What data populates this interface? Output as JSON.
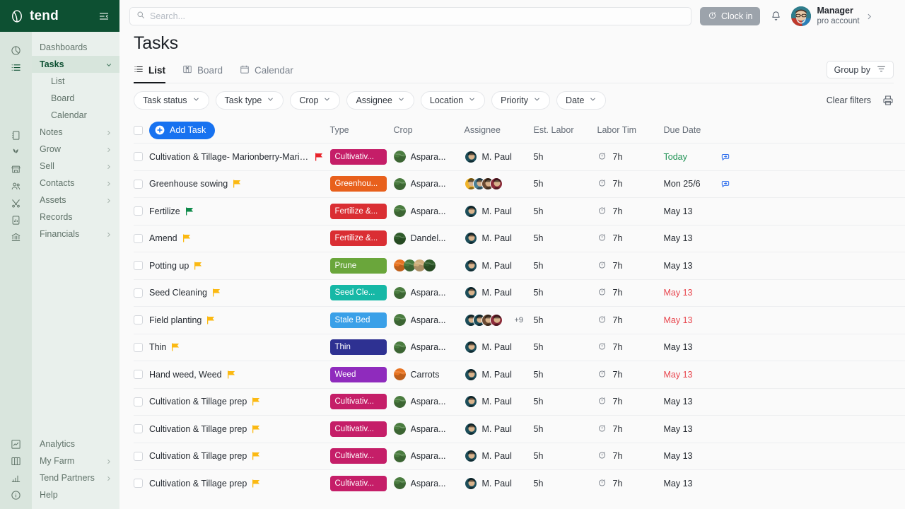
{
  "brand": {
    "name": "tend",
    "logo_icon": "tend-logo-icon",
    "collapse_icon": "collapse-sidebar-icon"
  },
  "sidebar": {
    "items": [
      {
        "label": "Dashboards",
        "icon": "pie-chart-icon",
        "active": false,
        "expandable": false
      },
      {
        "label": "Tasks",
        "icon": "list-icon",
        "active": true,
        "expandable": true
      },
      {
        "label": "Notes",
        "icon": "notebook-icon",
        "active": false,
        "expandable": true
      },
      {
        "label": "Grow",
        "icon": "sprout-icon",
        "active": false,
        "expandable": true
      },
      {
        "label": "Sell",
        "icon": "store-icon",
        "active": false,
        "expandable": true
      },
      {
        "label": "Contacts",
        "icon": "people-icon",
        "active": false,
        "expandable": true
      },
      {
        "label": "Assets",
        "icon": "tools-icon",
        "active": false,
        "expandable": true
      },
      {
        "label": "Records",
        "icon": "clipboard-chart-icon",
        "active": false,
        "expandable": false
      },
      {
        "label": "Financials",
        "icon": "bank-icon",
        "active": false,
        "expandable": true
      }
    ],
    "sub_items": [
      {
        "label": "List"
      },
      {
        "label": "Board"
      },
      {
        "label": "Calendar"
      }
    ],
    "bottom_items": [
      {
        "label": "Analytics",
        "icon": "line-chart-icon",
        "expandable": false
      },
      {
        "label": "My Farm",
        "icon": "columns-icon",
        "expandable": true
      },
      {
        "label": "Tend Partners",
        "icon": "bar-chart-icon",
        "expandable": true
      },
      {
        "label": "Help",
        "icon": "info-icon",
        "expandable": false
      }
    ]
  },
  "topbar": {
    "search_placeholder": "Search...",
    "search_value": "",
    "clock_in_label": "Clock in",
    "user_name": "Manager",
    "user_subtitle": "pro account"
  },
  "page": {
    "title": "Tasks",
    "tabs": [
      {
        "label": "List",
        "icon": "list-view-icon",
        "active": true
      },
      {
        "label": "Board",
        "icon": "board-view-icon",
        "active": false
      },
      {
        "label": "Calendar",
        "icon": "calendar-view-icon",
        "active": false
      }
    ],
    "group_by_label": "Group by",
    "clear_filters_label": "Clear filters",
    "filters": [
      {
        "label": "Task status"
      },
      {
        "label": "Task type"
      },
      {
        "label": "Crop"
      },
      {
        "label": "Assignee"
      },
      {
        "label": "Location"
      },
      {
        "label": "Priority"
      },
      {
        "label": "Date"
      }
    ]
  },
  "table": {
    "add_task_label": "Add Task",
    "columns": [
      "Type",
      "Crop",
      "Assignee",
      "Est. Labor",
      "Labor Tim",
      "Due Date"
    ],
    "rows": [
      {
        "name": "Cultivation & Tillage- Marionberry-Marionberry Generic - Ngu...",
        "flag": "#e8232a",
        "type": "Cultivativ...",
        "type_color": "#c51e68",
        "crops": [
          "#4a7c3f"
        ],
        "crop_name": "Aspara...",
        "assignees": [
          "#1d4e5a"
        ],
        "assignee_name": "M. Paul",
        "assignee_extra": "",
        "est_labor": "5h",
        "labor_time": "7h",
        "due_date": "Today",
        "due_color": "#1f9254",
        "repeat": true
      },
      {
        "name": "Greenhouse sowing",
        "flag": "#fbb912",
        "type": "Greenhou...",
        "type_color": "#e8601c",
        "crops": [
          "#4a7c3f"
        ],
        "crop_name": "Aspara...",
        "assignees": [
          "#f0b429",
          "#4a7f94",
          "#6b4a32",
          "#8c2b3a"
        ],
        "assignee_name": "",
        "assignee_extra": "",
        "est_labor": "5h",
        "labor_time": "7h",
        "due_date": "Mon 25/6",
        "due_color": "#262b32",
        "repeat": true
      },
      {
        "name": "Fertilize",
        "flag": "#0e8a4a",
        "type": "Fertilize &...",
        "type_color": "#da2e33",
        "crops": [
          "#4a7c3f"
        ],
        "crop_name": "Aspara...",
        "assignees": [
          "#1d4e5a"
        ],
        "assignee_name": "M. Paul",
        "assignee_extra": "",
        "est_labor": "5h",
        "labor_time": "7h",
        "due_date": "May 13",
        "due_color": "#262b32",
        "repeat": false
      },
      {
        "name": "Amend",
        "flag": "#fbb912",
        "type": "Fertilize &...",
        "type_color": "#da2e33",
        "crops": [
          "#2f5b2a"
        ],
        "crop_name": "Dandel...",
        "assignees": [
          "#1d4e5a"
        ],
        "assignee_name": "M. Paul",
        "assignee_extra": "",
        "est_labor": "5h",
        "labor_time": "7h",
        "due_date": "May 13",
        "due_color": "#262b32",
        "repeat": false
      },
      {
        "name": "Potting up",
        "flag": "#fbb912",
        "type": "Prune",
        "type_color": "#6aa63b",
        "crops": [
          "#e87422",
          "#4a7c3f",
          "#cfae7a",
          "#2f5b2a"
        ],
        "crop_name": "",
        "assignees": [
          "#1d4e5a"
        ],
        "assignee_name": "M. Paul",
        "assignee_extra": "",
        "est_labor": "5h",
        "labor_time": "7h",
        "due_date": "May 13",
        "due_color": "#262b32",
        "repeat": false
      },
      {
        "name": "Seed Cleaning",
        "flag": "#fbb912",
        "type": "Seed Cle...",
        "type_color": "#16b8a6",
        "crops": [
          "#4a7c3f"
        ],
        "crop_name": "Aspara...",
        "assignees": [
          "#1d4e5a"
        ],
        "assignee_name": "M. Paul",
        "assignee_extra": "",
        "est_labor": "5h",
        "labor_time": "7h",
        "due_date": "May 13",
        "due_color": "#e8474f",
        "repeat": false
      },
      {
        "name": "Field planting",
        "flag": "#fbb912",
        "type": "Stale Bed",
        "type_color": "#3aa0e8",
        "crops": [
          "#4a7c3f"
        ],
        "crop_name": "Aspara...",
        "assignees": [
          "#1d4e5a",
          "#1d4e5a",
          "#6b4a32",
          "#8c2b3a"
        ],
        "assignee_name": "",
        "assignee_extra": "+9",
        "est_labor": "5h",
        "labor_time": "7h",
        "due_date": "May 13",
        "due_color": "#e8474f",
        "repeat": false
      },
      {
        "name": "Thin",
        "flag": "#fbb912",
        "type": "Thin",
        "type_color": "#2e3192",
        "crops": [
          "#4a7c3f"
        ],
        "crop_name": "Aspara...",
        "assignees": [
          "#1d4e5a"
        ],
        "assignee_name": "M. Paul",
        "assignee_extra": "",
        "est_labor": "5h",
        "labor_time": "7h",
        "due_date": "May 13",
        "due_color": "#262b32",
        "repeat": false
      },
      {
        "name": "Hand weed, Weed",
        "flag": "#fbb912",
        "type": "Weed",
        "type_color": "#8f2bbd",
        "crops": [
          "#e87422"
        ],
        "crop_name": "Carrots",
        "assignees": [
          "#1d4e5a"
        ],
        "assignee_name": "M. Paul",
        "assignee_extra": "",
        "est_labor": "5h",
        "labor_time": "7h",
        "due_date": "May 13",
        "due_color": "#e8474f",
        "repeat": false
      },
      {
        "name": "Cultivation & Tillage prep",
        "flag": "#fbb912",
        "type": "Cultivativ...",
        "type_color": "#c51e68",
        "crops": [
          "#4a7c3f"
        ],
        "crop_name": "Aspara...",
        "assignees": [
          "#1d4e5a"
        ],
        "assignee_name": "M. Paul",
        "assignee_extra": "",
        "est_labor": "5h",
        "labor_time": "7h",
        "due_date": "May 13",
        "due_color": "#262b32",
        "repeat": false
      },
      {
        "name": "Cultivation & Tillage prep",
        "flag": "#fbb912",
        "type": "Cultivativ...",
        "type_color": "#c51e68",
        "crops": [
          "#4a7c3f"
        ],
        "crop_name": "Aspara...",
        "assignees": [
          "#1d4e5a"
        ],
        "assignee_name": "M. Paul",
        "assignee_extra": "",
        "est_labor": "5h",
        "labor_time": "7h",
        "due_date": "May 13",
        "due_color": "#262b32",
        "repeat": false
      },
      {
        "name": "Cultivation & Tillage prep",
        "flag": "#fbb912",
        "type": "Cultivativ...",
        "type_color": "#c51e68",
        "crops": [
          "#4a7c3f"
        ],
        "crop_name": "Aspara...",
        "assignees": [
          "#1d4e5a"
        ],
        "assignee_name": "M. Paul",
        "assignee_extra": "",
        "est_labor": "5h",
        "labor_time": "7h",
        "due_date": "May 13",
        "due_color": "#262b32",
        "repeat": false
      },
      {
        "name": "Cultivation & Tillage prep",
        "flag": "#fbb912",
        "type": "Cultivativ...",
        "type_color": "#c51e68",
        "crops": [
          "#4a7c3f"
        ],
        "crop_name": "Aspara...",
        "assignees": [
          "#1d4e5a"
        ],
        "assignee_name": "M. Paul",
        "assignee_extra": "",
        "est_labor": "5h",
        "labor_time": "7h",
        "due_date": "May 13",
        "due_color": "#262b32",
        "repeat": false
      }
    ]
  },
  "colors": {
    "brand_green": "#0d5032",
    "accent_blue": "#1772f0",
    "overdue_red": "#e8474f",
    "today_green": "#1f9254"
  }
}
